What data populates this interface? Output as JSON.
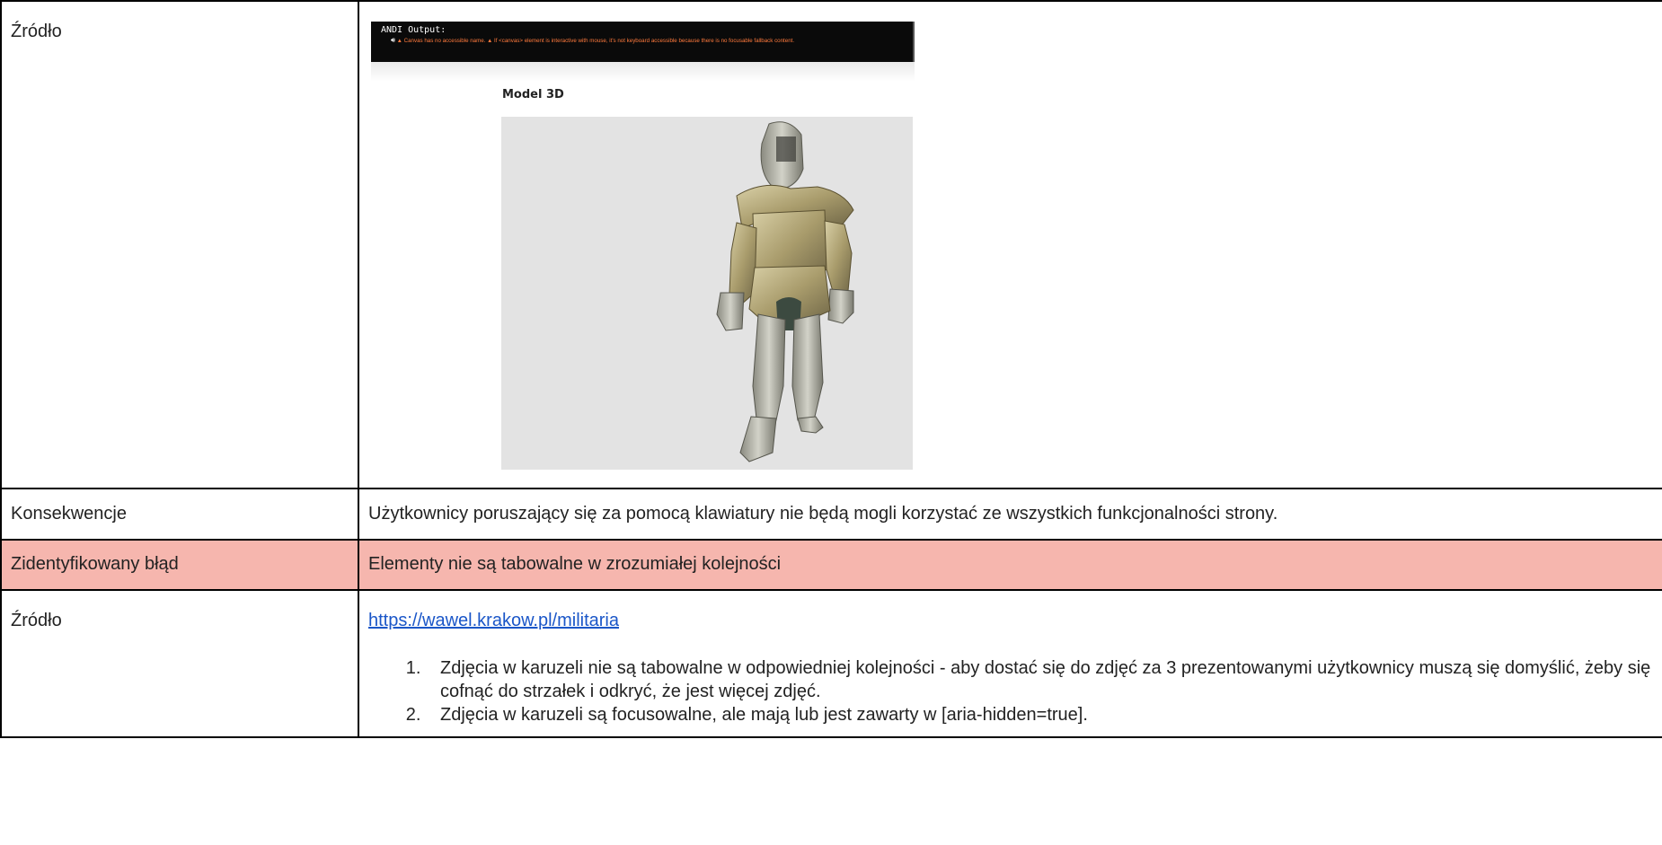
{
  "rows": {
    "row1": {
      "label": "Źródło"
    },
    "row2": {
      "label": "Konsekwencje",
      "value": "Użytkownicy poruszający się za pomocą klawiatury nie będą mogli korzystać ze wszystkich funkcjonalności strony."
    },
    "row3": {
      "label": "Zidentyfikowany błąd",
      "value": "Elementy nie są tabowalne w zrozumiałej kolejności"
    },
    "row4": {
      "label": "Źródło",
      "link": "https://wawel.krakow.pl/militaria",
      "items": [
        "Zdjęcia w karuzeli nie są tabowalne w odpowiedniej kolejności - aby dostać się do zdjęć za 3 prezentowanymi użytkownicy muszą się domyślić, żeby się cofnąć do strzałek i odkryć, że jest więcej zdjęć.",
        "Zdjęcia w karuzeli są focusowalne, ale mają lub jest zawarty w [aria-hidden=true]."
      ]
    }
  },
  "screenshot": {
    "andi_title": "ANDI Output:",
    "andi_message": "▲ Canvas has no accessible name. ▲ If <canvas> element is interactive with mouse, it's not keyboard accessible because there is no focusable fallback content.",
    "andi_speaker_icon": "speaker-icon",
    "model_title": "Model 3D",
    "viewer_image": "armor-3d-model"
  },
  "colors": {
    "highlight": "#f6b6ae",
    "link": "#1a56c8",
    "andi_warning": "#ff7a3d"
  }
}
